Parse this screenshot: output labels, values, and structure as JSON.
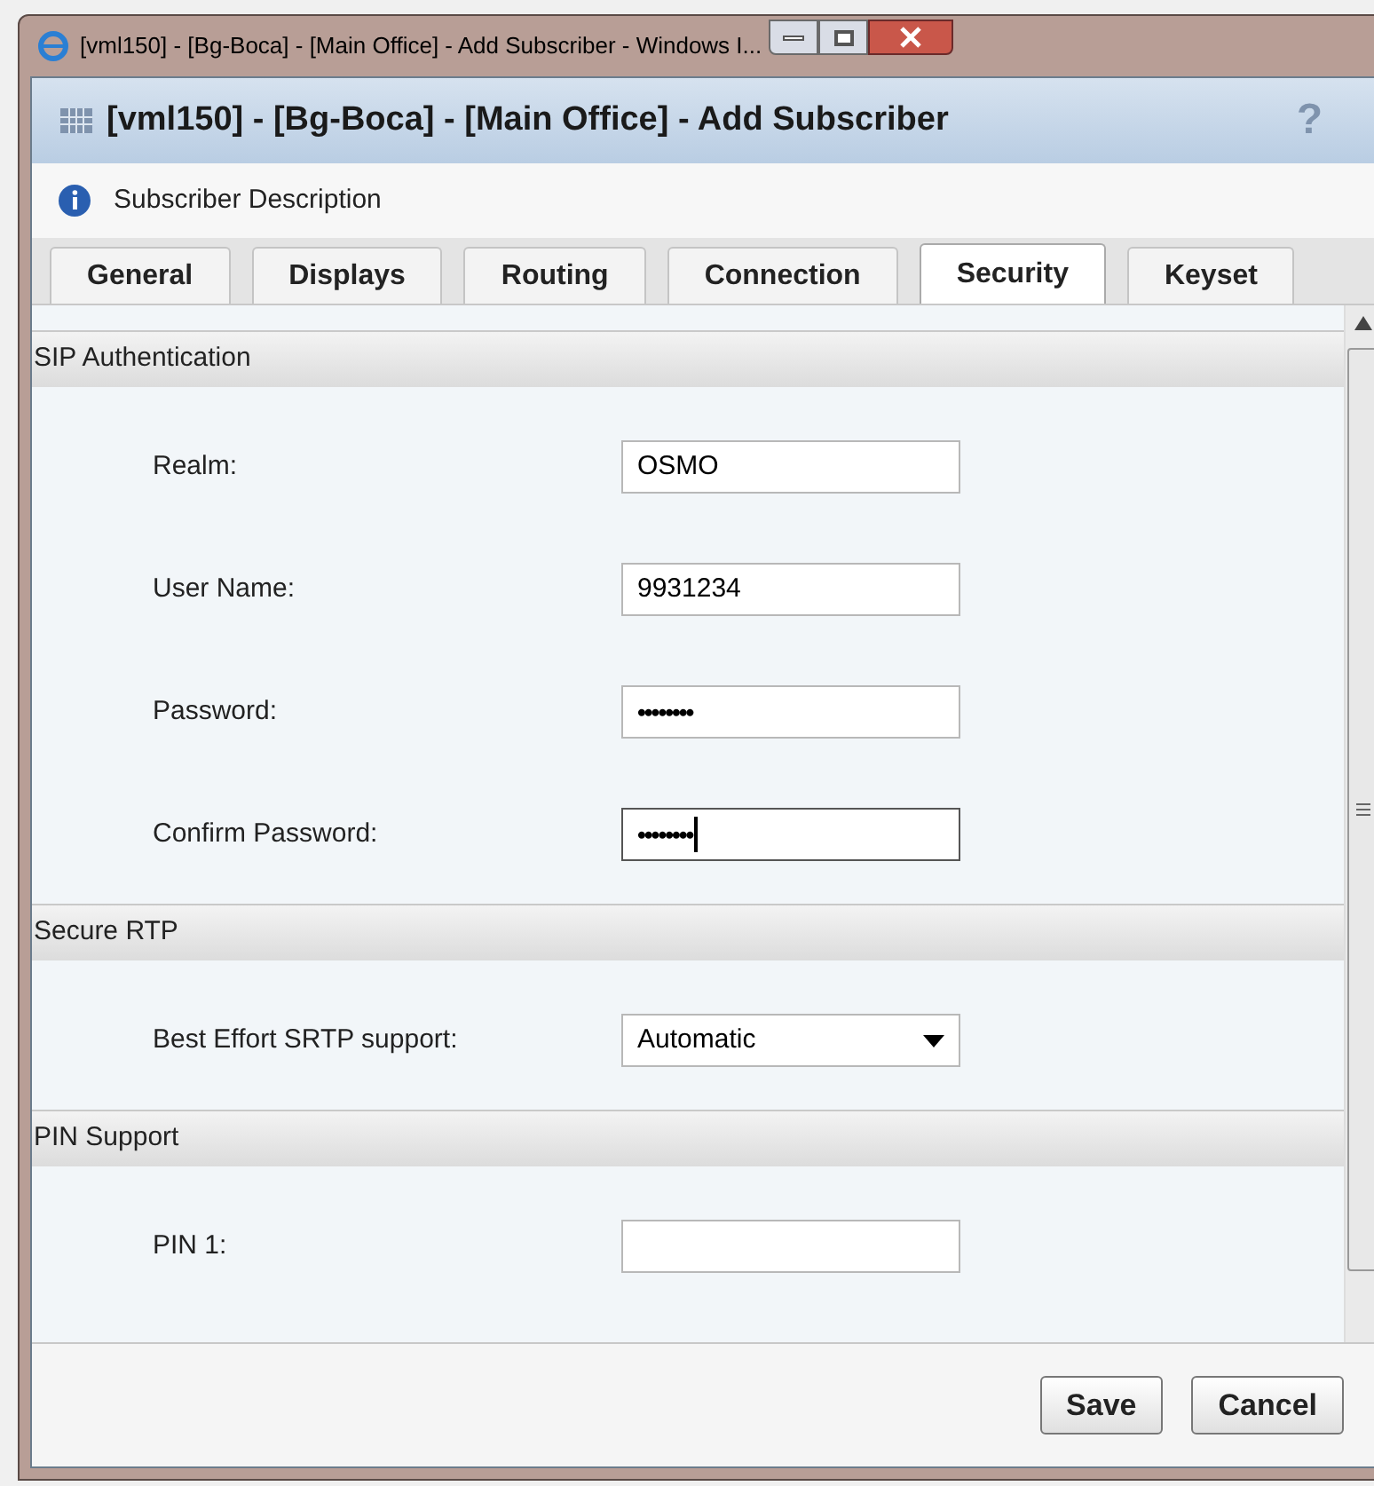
{
  "window": {
    "title": "[vml150] - [Bg-Boca] - [Main Office] - Add Subscriber - Windows I..."
  },
  "dialog": {
    "title": "[vml150] - [Bg-Boca] - [Main Office] - Add Subscriber",
    "help": "?"
  },
  "description": "Subscriber Description",
  "tabs": [
    {
      "label": "General",
      "selected": false
    },
    {
      "label": "Displays",
      "selected": false
    },
    {
      "label": "Routing",
      "selected": false
    },
    {
      "label": "Connection",
      "selected": false
    },
    {
      "label": "Security",
      "selected": true
    },
    {
      "label": "Keyset",
      "selected": false
    }
  ],
  "sections": [
    {
      "title": "SIP Authentication",
      "fields": [
        {
          "label": "Realm:",
          "kind": "text",
          "value": "OSMO",
          "focused": false
        },
        {
          "label": "User Name:",
          "kind": "text",
          "value": "9931234",
          "focused": false
        },
        {
          "label": "Password:",
          "kind": "password",
          "value": "••••••••",
          "focused": false
        },
        {
          "label": "Confirm Password:",
          "kind": "password",
          "value": "••••••••",
          "focused": true
        }
      ]
    },
    {
      "title": "Secure RTP",
      "fields": [
        {
          "label": "Best Effort SRTP support:",
          "kind": "select",
          "value": "Automatic",
          "focused": false
        }
      ]
    },
    {
      "title": "PIN Support",
      "fields": [
        {
          "label": "PIN 1:",
          "kind": "text",
          "focused": false
        }
      ]
    }
  ],
  "buttons": [
    "Save",
    "Cancel"
  ]
}
